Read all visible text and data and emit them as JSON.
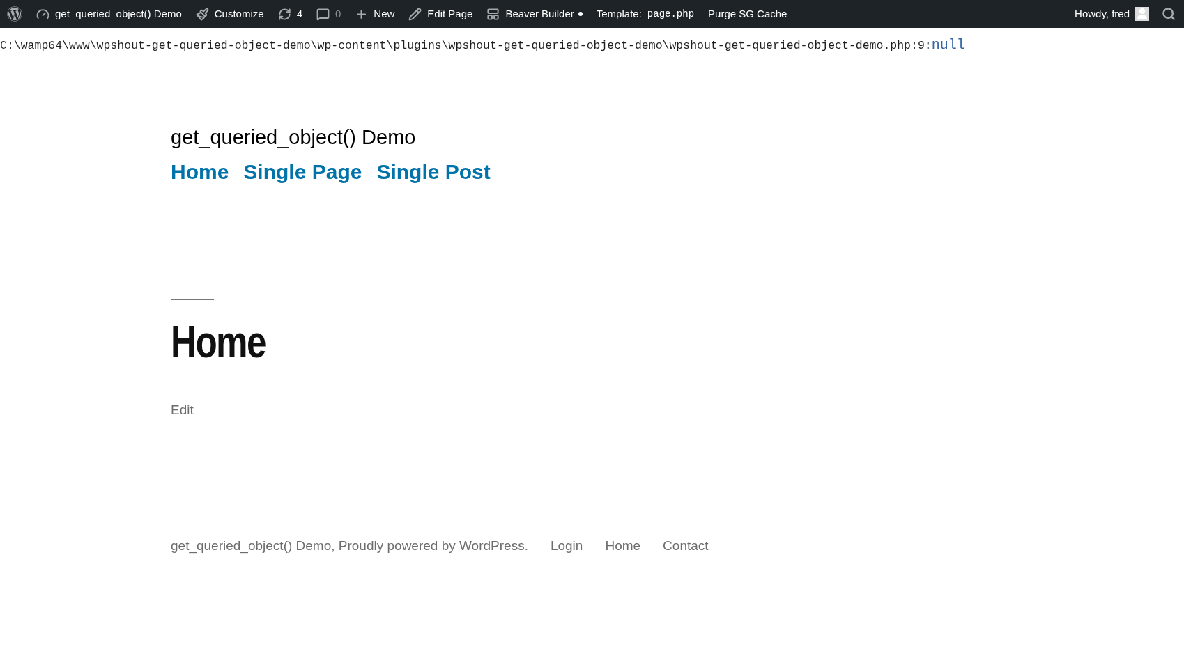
{
  "admin_bar": {
    "items": [
      {
        "kind": "logo"
      },
      {
        "kind": "site",
        "label": "get_queried_object() Demo"
      },
      {
        "kind": "customize",
        "label": "Customize"
      },
      {
        "kind": "updates",
        "label": "4"
      },
      {
        "kind": "comments",
        "label": "0",
        "muted": true
      },
      {
        "kind": "new",
        "label": "New"
      },
      {
        "kind": "edit",
        "label": "Edit Page"
      },
      {
        "kind": "builder",
        "label": "Beaver Builder"
      },
      {
        "kind": "template",
        "label": "Template:",
        "code": "page.php"
      },
      {
        "kind": "text",
        "label": "Purge SG Cache"
      }
    ],
    "account": {
      "label": "Howdy, fred"
    }
  },
  "debug": {
    "path": "C:\\wamp64\\www\\wpshout-get-queried-object-demo\\wp-content\\plugins\\wpshout-get-queried-object-demo\\wpshout-get-queried-object-demo.php:9:",
    "value": "null"
  },
  "site": {
    "title": "get_queried_object() Demo",
    "menu": [
      "Home",
      "Single Page",
      "Single Post"
    ]
  },
  "entry": {
    "title": "Home",
    "edit": "Edit"
  },
  "footer": {
    "credit": "get_queried_object() Demo, Proudly powered by WordPress.",
    "links": [
      "Login",
      "Home",
      "Contact"
    ]
  }
}
